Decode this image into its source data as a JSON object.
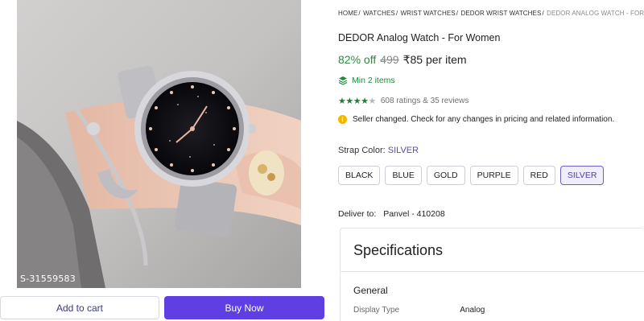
{
  "image": {
    "code": "S-31559583"
  },
  "buttons": {
    "add_to_cart": "Add to cart",
    "buy_now": "Buy Now"
  },
  "breadcrumb": {
    "items": [
      "HOME",
      "WATCHES",
      "WRIST WATCHES",
      "DEDOR WRIST WATCHES"
    ],
    "current": "DEDOR ANALOG WATCH - FOR WOMEN",
    "separator": "/"
  },
  "product": {
    "title": "DEDOR Analog Watch  - For Women",
    "discount": "82% off",
    "mrp": "499",
    "price": "₹85 per item",
    "min_items": "Min 2 items",
    "rating_stars": 4,
    "ratings_text": "608 ratings & 35 reviews",
    "notice": "Seller changed. Check for any changes in pricing and related information."
  },
  "strap": {
    "label": "Strap Color:",
    "selected": "SILVER",
    "options": [
      "BLACK",
      "BLUE",
      "GOLD",
      "PURPLE",
      "RED",
      "SILVER"
    ]
  },
  "delivery": {
    "label": "Deliver to:",
    "location": "Panvel - 410208"
  },
  "specifications": {
    "title": "Specifications",
    "section": "General",
    "rows": [
      {
        "key": "Display Type",
        "value": "Analog"
      }
    ]
  },
  "colors": {
    "accent": "#5f3fe3",
    "discount": "#2b8a3e",
    "star": "#2b7a3a",
    "notice": "#f2b600"
  }
}
